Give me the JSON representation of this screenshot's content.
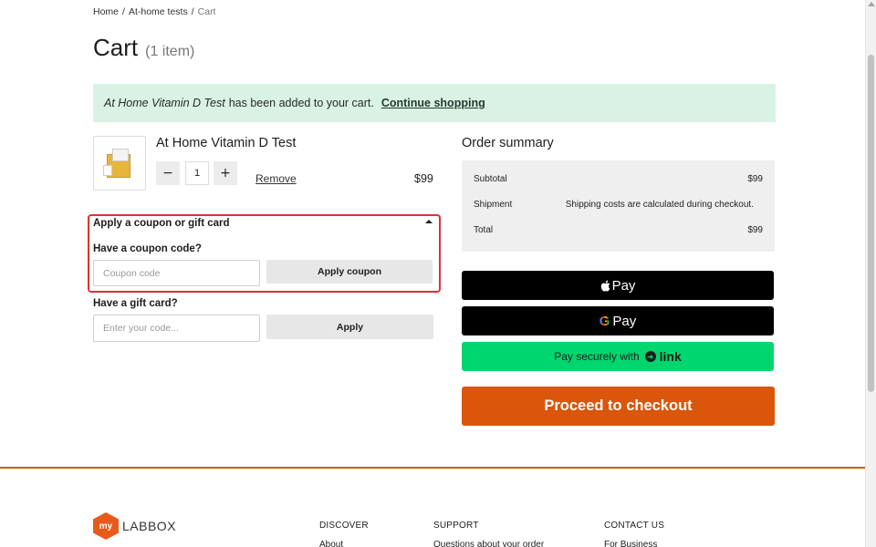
{
  "breadcrumb": {
    "items": [
      "Home",
      "At-home tests"
    ],
    "separator": "/",
    "current": "Cart"
  },
  "page": {
    "title": "Cart",
    "item_count": "(1 item)"
  },
  "alert": {
    "product_name": "At Home Vitamin D Test",
    "message": "has been added to your cart.",
    "link": "Continue shopping"
  },
  "cart_item": {
    "name": "At Home Vitamin D Test",
    "quantity": "1",
    "minus": "−",
    "plus": "+",
    "remove": "Remove",
    "price": "$99"
  },
  "coupon": {
    "header": "Apply a coupon or gift card",
    "coupon_label": "Have a coupon code?",
    "coupon_placeholder": "Coupon code",
    "coupon_button": "Apply coupon",
    "gift_label": "Have a gift card?",
    "gift_placeholder": "Enter your code...",
    "gift_button": "Apply"
  },
  "summary": {
    "title": "Order summary",
    "rows": [
      {
        "label": "Subtotal",
        "value": "$99"
      },
      {
        "label": "Shipment",
        "value": "Shipping costs are calculated during checkout."
      },
      {
        "label": "Total",
        "value": "$99"
      }
    ]
  },
  "payment": {
    "apple_pay": "Pay",
    "apple_symbol": "",
    "google_pay": "Pay",
    "google_letter": "G",
    "link_prefix": "Pay securely with",
    "link_word": "link"
  },
  "checkout": {
    "label": "Proceed to checkout"
  },
  "footer": {
    "logo_badge": "my",
    "logo_text": "LABBOX",
    "columns": [
      {
        "heading": "DISCOVER",
        "link": "About"
      },
      {
        "heading": "SUPPORT",
        "link": "Questions about your order"
      },
      {
        "heading": "CONTACT US",
        "link": "For Business"
      }
    ]
  },
  "colors": {
    "accent": "#d9560b",
    "alert_bg": "#d9f2e3",
    "link_green": "#00d66f",
    "highlight_border": "#e0303a"
  }
}
